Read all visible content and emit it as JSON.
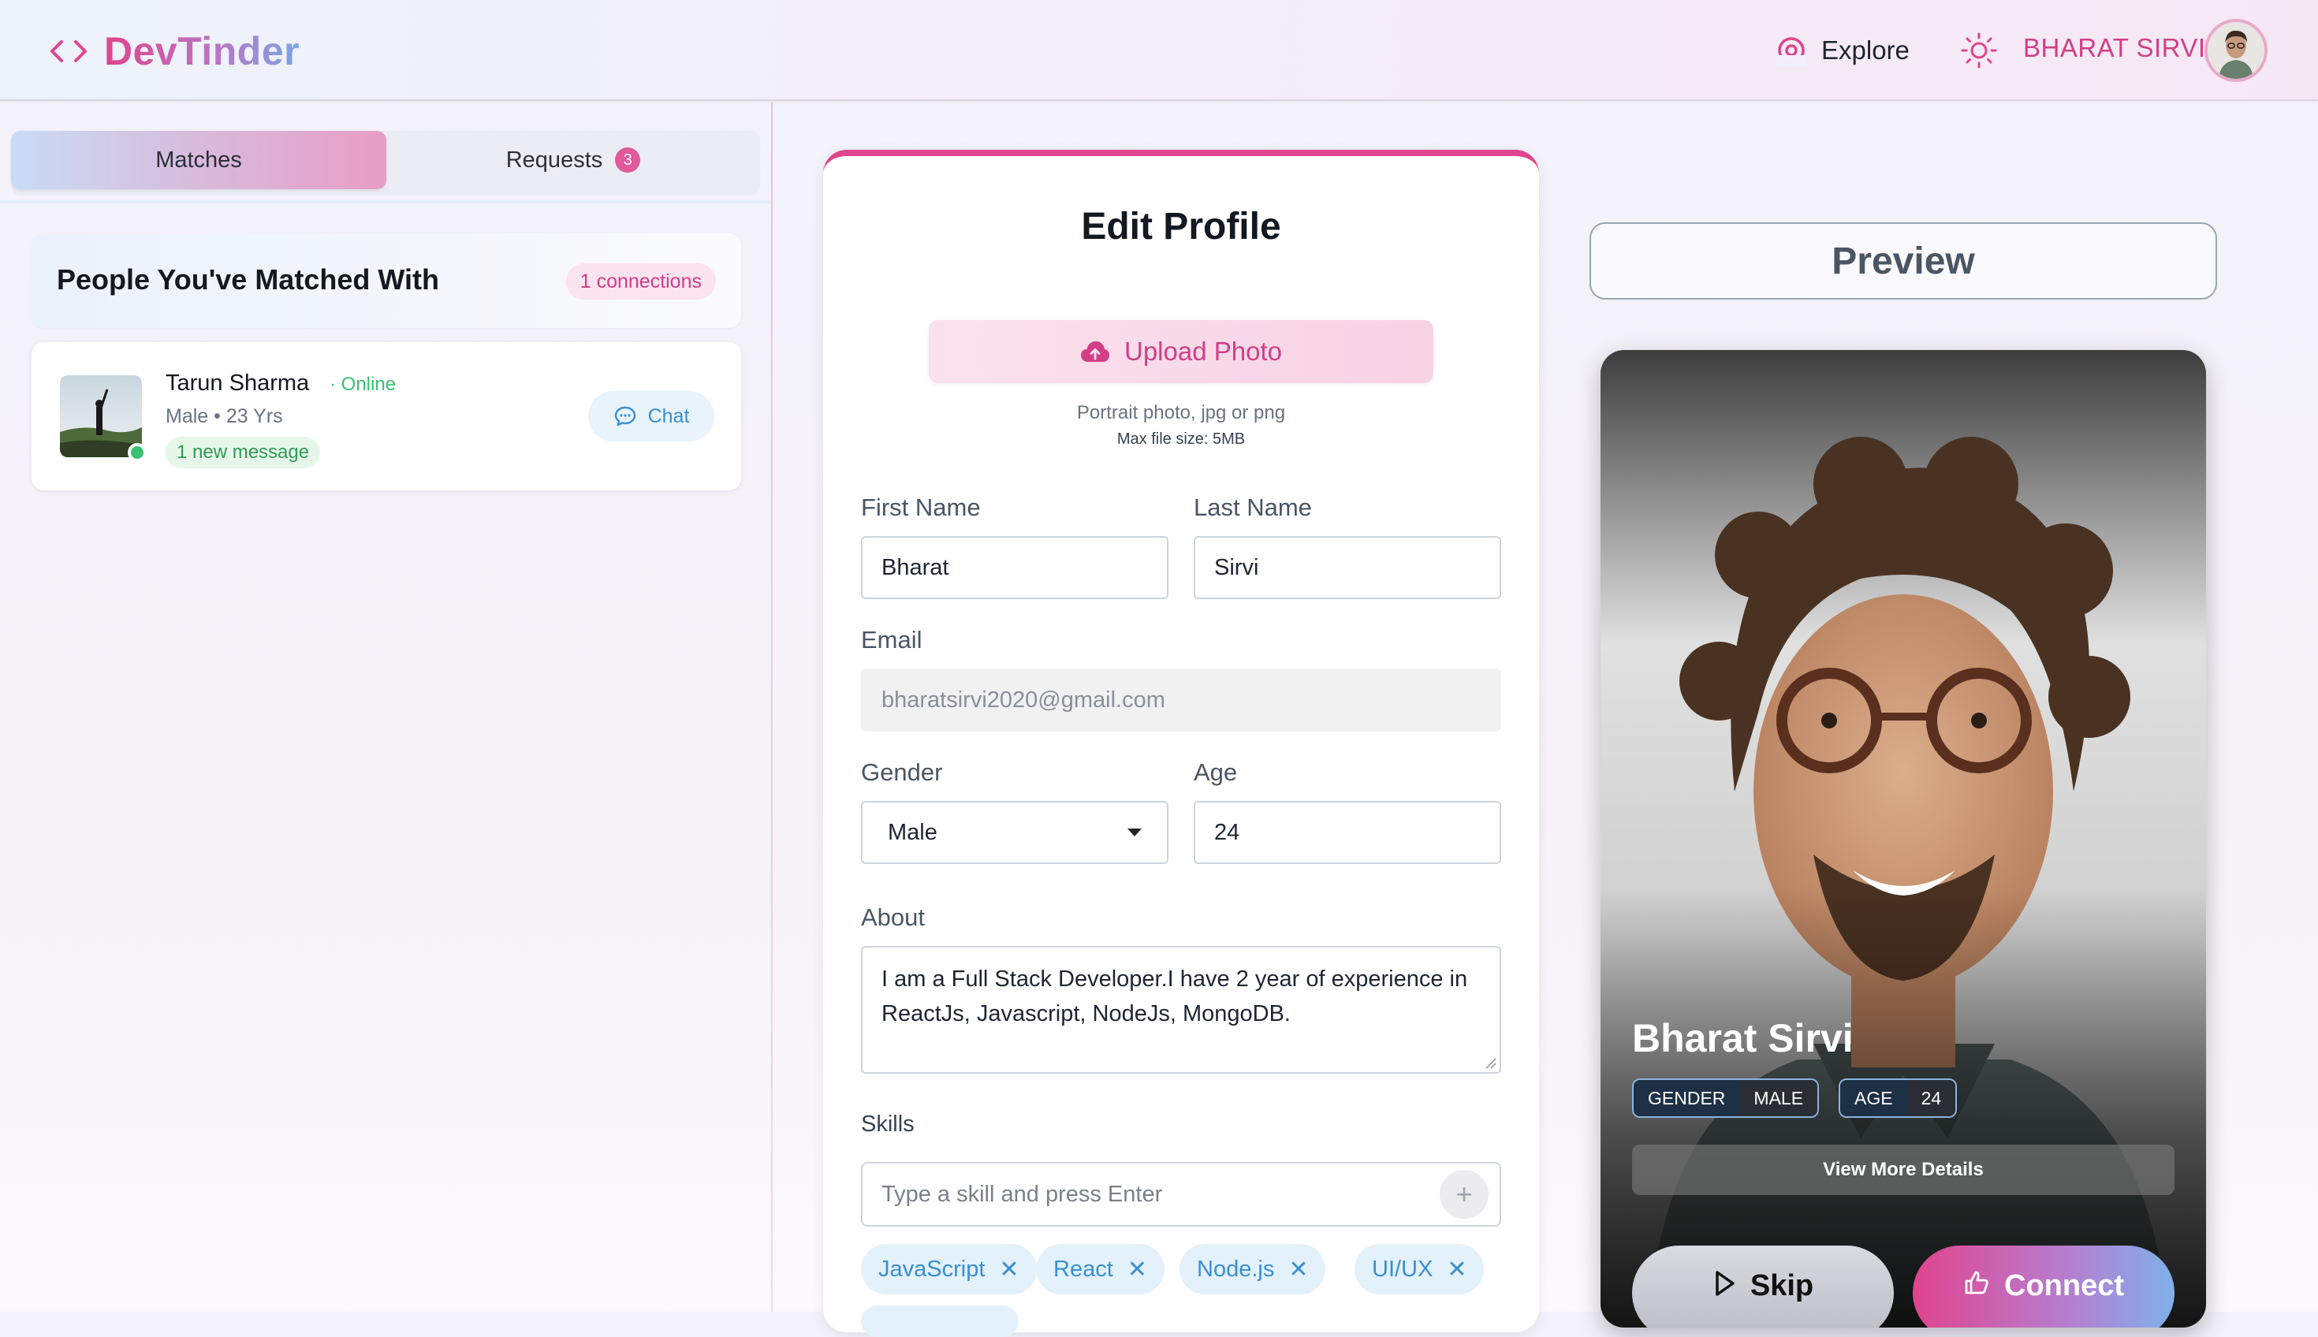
{
  "navbar": {
    "brand": "DevTinder",
    "explore_label": "Explore",
    "username": "BHARAT SIRVI",
    "colors": {
      "brand_pink": "#e0448e",
      "brand_blue": "#7aa6e6",
      "username": "#d23e87"
    }
  },
  "sidebar": {
    "tabs": [
      {
        "label": "Matches",
        "active": true
      },
      {
        "label": "Requests",
        "count": "3"
      }
    ],
    "matched_title": "People You've Matched With",
    "connections_badge": "1 connections",
    "matches": [
      {
        "name": "Tarun Sharma",
        "status": "· Online",
        "meta": "Male • 23 Yrs",
        "new_message": "1 new message",
        "chat_label": "Chat"
      }
    ]
  },
  "edit_profile": {
    "title": "Edit Profile",
    "upload_label": "Upload Photo",
    "upload_hint": "Portrait photo, jpg or png",
    "upload_size_hint": "Max file size: 5MB",
    "first_name": {
      "label": "First Name",
      "value": "Bharat"
    },
    "last_name": {
      "label": "Last Name",
      "value": "Sirvi"
    },
    "email": {
      "label": "Email",
      "value": "bharatsirvi2020@gmail.com"
    },
    "gender": {
      "label": "Gender",
      "value": "Male"
    },
    "age": {
      "label": "Age",
      "value": "24"
    },
    "about": {
      "label": "About",
      "value": "I am a Full Stack Developer.I have 2 year of experience in ReactJs, Javascript, NodeJs, MongoDB."
    },
    "skills": {
      "label": "Skills",
      "placeholder": "Type a skill and press Enter",
      "add_symbol": "+",
      "remove_symbol": "✕",
      "items": [
        "JavaScript",
        "React",
        "Node.js",
        "UI/UX"
      ]
    }
  },
  "preview": {
    "button_label": "Preview",
    "card": {
      "name": "Bharat Sirvi",
      "gender_key": "GENDER",
      "gender_value": "MALE",
      "age_key": "AGE",
      "age_value": "24",
      "view_more_label": "View More Details",
      "skip_label": "Skip",
      "connect_label": "Connect"
    }
  }
}
